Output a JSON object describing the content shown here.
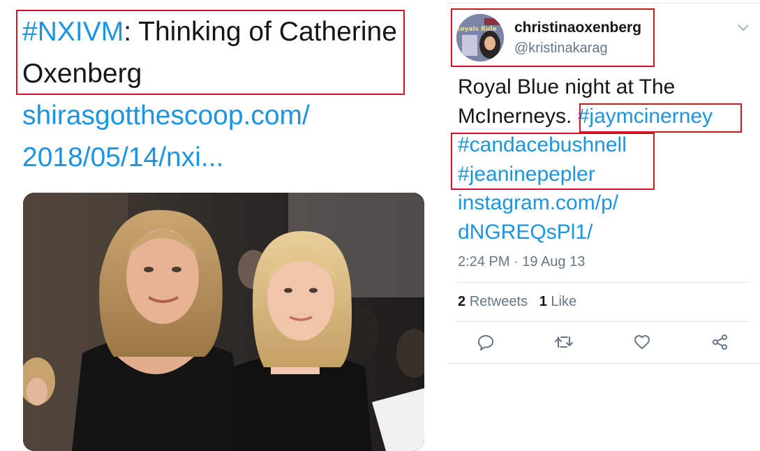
{
  "left_tweet": {
    "hashtag": "#NXIVM",
    "text_after_hashtag": ": Thinking of Catherine Oxenberg",
    "link_line1": "shirasgotthescoop.com/",
    "link_line2": "2018/05/14/nxi..."
  },
  "right_tweet": {
    "display_name": "christinaoxenberg",
    "handle": "@kristinakarag",
    "text": "Royal Blue night at The McInerneys.",
    "hashtags": [
      "#jaymcinerney",
      "#candacebushnell",
      "#jeaninepepler"
    ],
    "link_line1": "instagram.com/p/",
    "link_line2": "dNGREQsPl1/",
    "timestamp": "2:24 PM · 19 Aug 13",
    "retweets_count": "2",
    "retweets_label": "Retweets",
    "likes_count": "1",
    "likes_label": "Like",
    "avatar_text": "Royals Rule"
  },
  "icons": [
    "reply-icon",
    "retweet-icon",
    "like-icon",
    "share-icon",
    "chevron-down-icon"
  ],
  "colors": {
    "link": "#1b95e0",
    "text": "#14171a",
    "muted": "#657786",
    "annotation": "#d0161f"
  }
}
